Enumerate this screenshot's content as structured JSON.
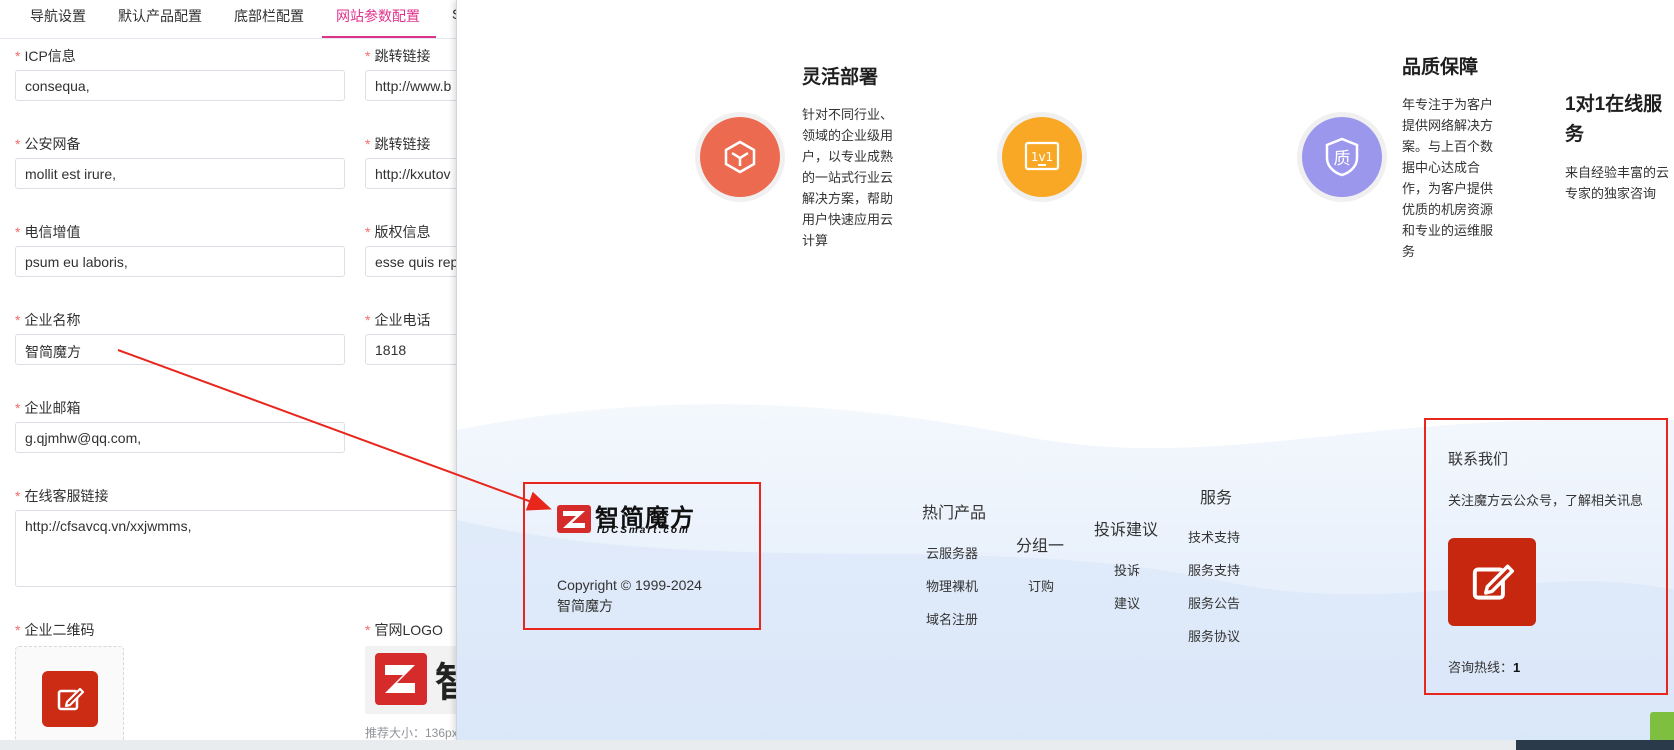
{
  "tabs": [
    {
      "label": "导航设置",
      "active": false
    },
    {
      "label": "默认产品配置",
      "active": false
    },
    {
      "label": "底部栏配置",
      "active": false
    },
    {
      "label": "网站参数配置",
      "active": true
    },
    {
      "label": "S",
      "active": false
    }
  ],
  "form": {
    "icp_label": "ICP信息",
    "icp_value": "consequa,",
    "jump1_label": "跳转链接",
    "jump1_value": "http://www.b",
    "police_label": "公安网备",
    "police_value": "mollit est irure,",
    "jump2_label": "跳转链接",
    "jump2_value": "http://kxutov",
    "telecom_label": "电信增值",
    "telecom_value": "psum eu laboris,",
    "copyright_label": "版权信息",
    "copyright_value": "esse quis rep",
    "company_label": "企业名称",
    "company_value": "智简魔方",
    "phone_label": "企业电话",
    "phone_value": "1818",
    "email_label": "企业邮箱",
    "email_value": "g.qjmhw@qq.com,",
    "service_label": "在线客服链接",
    "service_value": "http://cfsavcq.vn/xxjwmms,",
    "qr_label": "企业二维码",
    "logo_label": "官网LOGO",
    "logo_char": "智",
    "logo_hint": "推荐大小：136px",
    "required_mark": "*"
  },
  "features": [
    {
      "title": "灵活部署",
      "desc": "针对不同行业、领域的企业级用户，以专业成熟的一站式行业云解决方案，帮助用户快速应用云计算",
      "icon": "cube-icon",
      "color": "#ec6a4f"
    },
    {
      "title": "1对1在线服务",
      "desc": "来自经验丰富的云专家的独家咨询",
      "icon": "1v1-icon",
      "color": "#f9a825",
      "icon_text": "1v1"
    },
    {
      "title": "品质保障",
      "desc": "年专注于为客户提供网络解决方案。与上百个数据中心达成合作，为客户提供优质的机房资源和专业的运维服务",
      "icon": "shield-icon",
      "color": "#9b97ec",
      "icon_text": "质"
    }
  ],
  "footer": {
    "logo_text": "智简魔方",
    "logo_sub": "IDCSmart.com",
    "copyright": "Copyright © 1999-2024",
    "company": "智简魔方",
    "columns": [
      {
        "title": "热门产品",
        "links": [
          "云服务器",
          "物理裸机",
          "域名注册"
        ]
      },
      {
        "title": "分组一",
        "links": [
          "订购"
        ]
      },
      {
        "title": "投诉建议",
        "links": [
          "投诉",
          "建议"
        ]
      },
      {
        "title": "服务",
        "links": [
          "技术支持",
          "服务支持",
          "服务公告",
          "服务协议"
        ]
      }
    ],
    "contact_title": "联系我们",
    "contact_desc": "关注魔方云公众号，了解相关讯息",
    "hotline_label": "咨询热线：",
    "hotline_value": "1"
  },
  "colors": {
    "accent_tab": "#e0338c",
    "annotation_red": "#e8261c",
    "brand_red": "#c7270f"
  }
}
